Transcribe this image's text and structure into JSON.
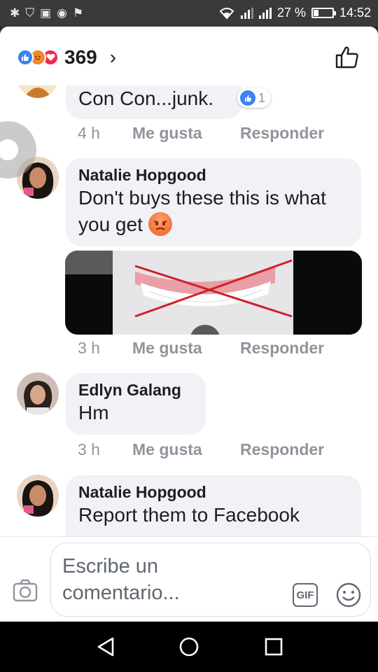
{
  "status_bar": {
    "battery": "27 %",
    "battery_level": 0.27,
    "time": "14:52",
    "left_icons": [
      "bug-icon",
      "shield-icon",
      "image-icon",
      "messenger-icon",
      "flag-icon"
    ]
  },
  "header": {
    "reaction_count": "369",
    "reactions": [
      "like",
      "angry",
      "love"
    ],
    "chevron": "›"
  },
  "comments": [
    {
      "text": "Con Con...junk.",
      "reaction_count": "1",
      "time": "4 h",
      "like_label": "Me gusta",
      "reply_label": "Responder"
    },
    {
      "author": "Natalie Hopgood",
      "text": "Don't buys these this is what you get",
      "time": "3 h",
      "like_label": "Me gusta",
      "reply_label": "Responder"
    },
    {
      "author": "Edlyn Galang",
      "text": "Hm",
      "time": "3 h",
      "like_label": "Me gusta",
      "reply_label": "Responder"
    },
    {
      "author": "Natalie Hopgood",
      "text": "Report them to Facebook"
    }
  ],
  "composer": {
    "placeholder": "Escribe un comentario...",
    "gif_label": "GIF"
  },
  "colors": {
    "like_blue": "#3b82f6",
    "angry_orange": "#f08a2a",
    "love_red": "#f0284a",
    "bubble_bg": "#f0f2f5",
    "meta_gray": "#90949c"
  }
}
